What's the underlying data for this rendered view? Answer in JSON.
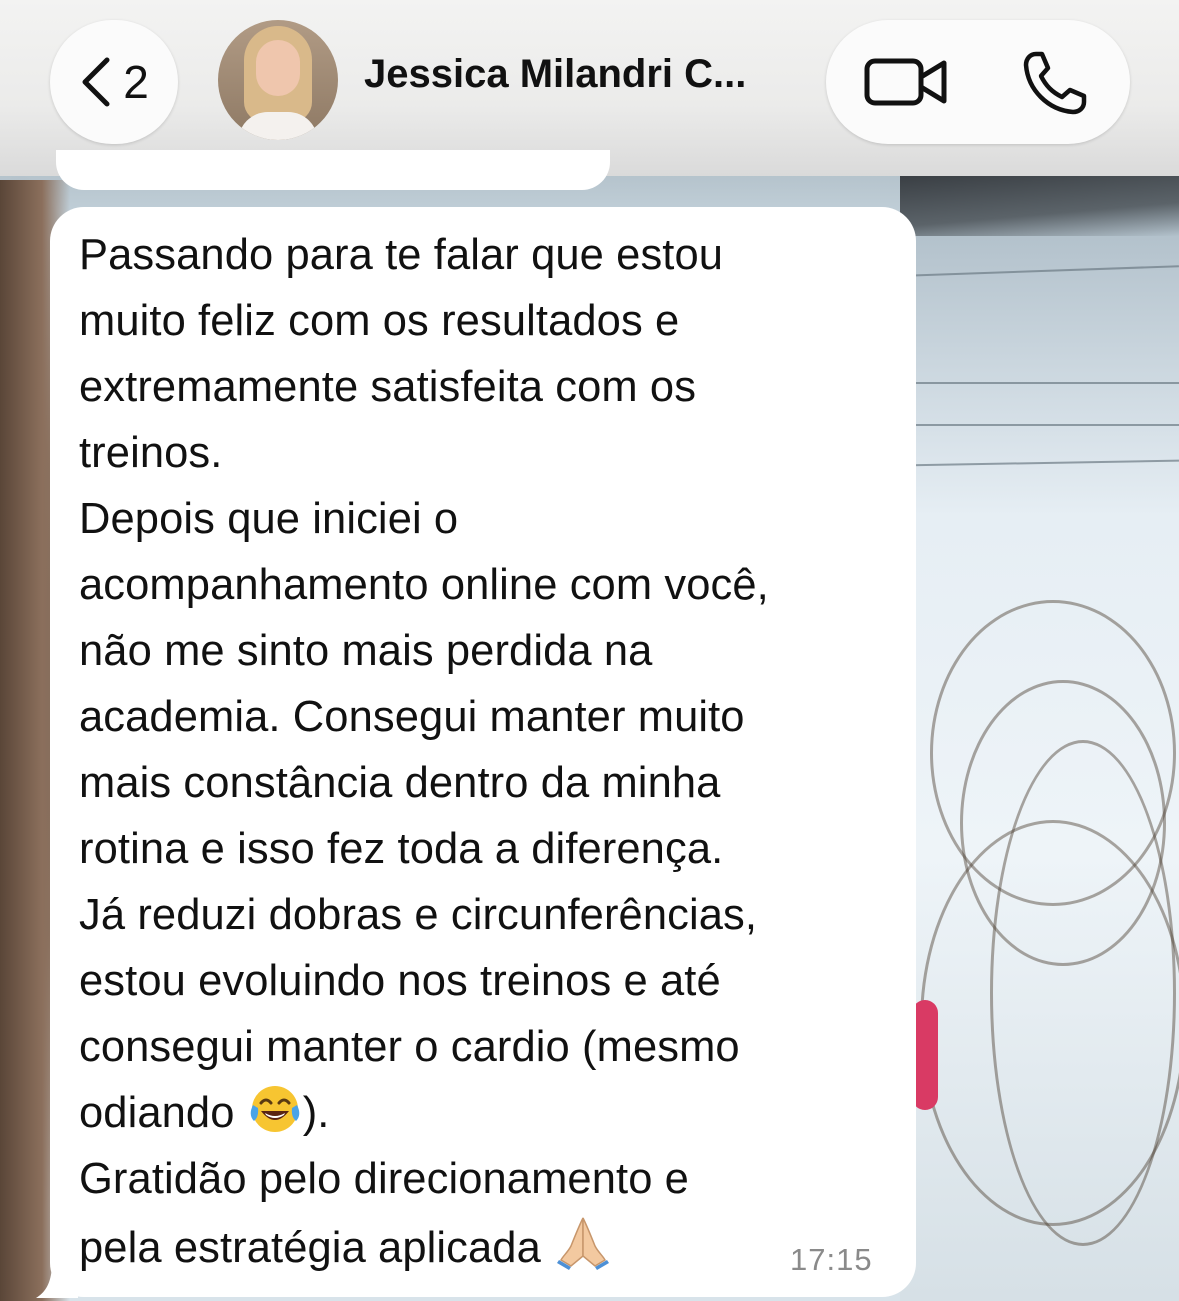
{
  "header": {
    "back_count": "2",
    "contact_name": "Jessica Milandri C...",
    "icons": {
      "back": "chevron-left-icon",
      "video": "video-call-icon",
      "phone": "phone-call-icon"
    }
  },
  "message": {
    "lines": [
      "Passando para te falar que estou",
      "muito feliz com os resultados e",
      "extremamente satisfeita com os",
      "treinos.",
      "Depois que iniciei o",
      "acompanhamento online com você,",
      "não me sinto mais perdida na",
      "academia. Consegui manter muito",
      "mais constância dentro da minha",
      "rotina e isso fez toda a diferença.",
      "Já reduzi dobras e circunferências,",
      "estou evoluindo nos treinos e até",
      "consegui manter o cardio (mesmo",
      "odiando",
      ").",
      "Gratidão pelo direcionamento e",
      "pela estratégia aplicada"
    ],
    "emoji_laugh": "face-with-tears-of-joy-icon",
    "emoji_pray": "folded-hands-icon",
    "time": "17:15"
  }
}
